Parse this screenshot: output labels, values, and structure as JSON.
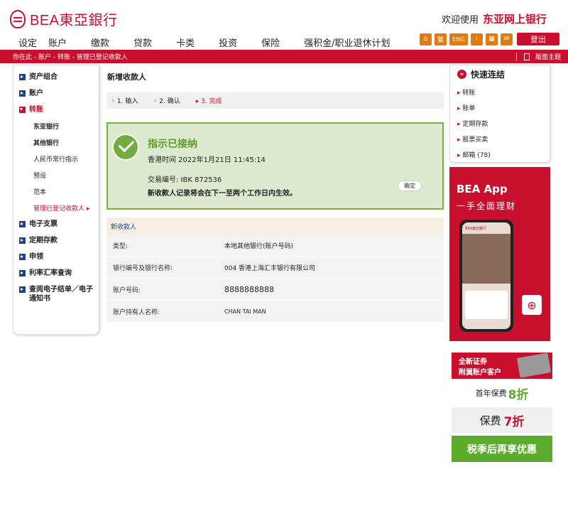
{
  "brand": {
    "logo_text": "BEA東亞銀行",
    "welcome_prefix": "欢迎使用",
    "welcome_name": "东亚网上银行"
  },
  "topnav": [
    "设定",
    "账户",
    "缴款",
    "贷款",
    "卡类",
    "投资",
    "保险",
    "强积金/职业退休计划"
  ],
  "util": {
    "home_icon": "⌂",
    "trad_label": "繁",
    "eng_label": "ENG",
    "info_icon": "i",
    "calc_icon": "▦",
    "mail_icon": "✉",
    "logout_label": "登出"
  },
  "breadcrumb": {
    "text": "你在此 - 账户  - 转账 - 管理已登记收款人",
    "theme_label": "版面主题"
  },
  "sidebar": {
    "items": [
      {
        "label": "资产组合"
      },
      {
        "label": "账户"
      },
      {
        "label": "转账"
      },
      {
        "label": "电子支票"
      },
      {
        "label": "定期存款"
      },
      {
        "label": "申领"
      },
      {
        "label": "利率汇率查询"
      },
      {
        "label": "查阅电子结单／电子通知书"
      }
    ],
    "subs": [
      "东亚银行",
      "其他银行",
      "人民币常行指示",
      "预设",
      "范本",
      "管理已登记收款人"
    ]
  },
  "main": {
    "title": "新增收款人",
    "steps": [
      "1. 输入",
      "2. 确认",
      "3. 完成"
    ],
    "success": {
      "title": "指示已接纳",
      "time": "香港时间 2022年1月21日 11:45:14",
      "ref": "交易编号: IBK 872536",
      "msg": "新收款人记录将会在下一至两个工作日内生效。",
      "ok_label": "确定"
    },
    "detail": {
      "header": "新收款人",
      "rows": [
        {
          "k": "类型:",
          "v": "本地其他银行(账户号码)"
        },
        {
          "k": "银行编号及银行名称:",
          "v": "004 香港上海汇丰银行有限公司"
        },
        {
          "k": "账户号码:",
          "v": "8888888888"
        },
        {
          "k": "账户持有人名称:",
          "v": "CHAN TAI MAN"
        }
      ]
    }
  },
  "quick": {
    "title": "快速连结",
    "links": [
      "转账",
      "账单",
      "定期存款",
      "股票买卖",
      "邮箱 (78)"
    ]
  },
  "ad1": {
    "title": "BEA App",
    "subtitle": "一手全面理财",
    "phone_brand": "BEA東亞銀行"
  },
  "ad2": {
    "top1": "全新证券",
    "top2": "附属账户客户",
    "line1_prefix": "首年保费",
    "line1_value": "8折",
    "line2_prefix": "保费",
    "line2_value": "7折",
    "line3": "税季后再享优惠"
  }
}
